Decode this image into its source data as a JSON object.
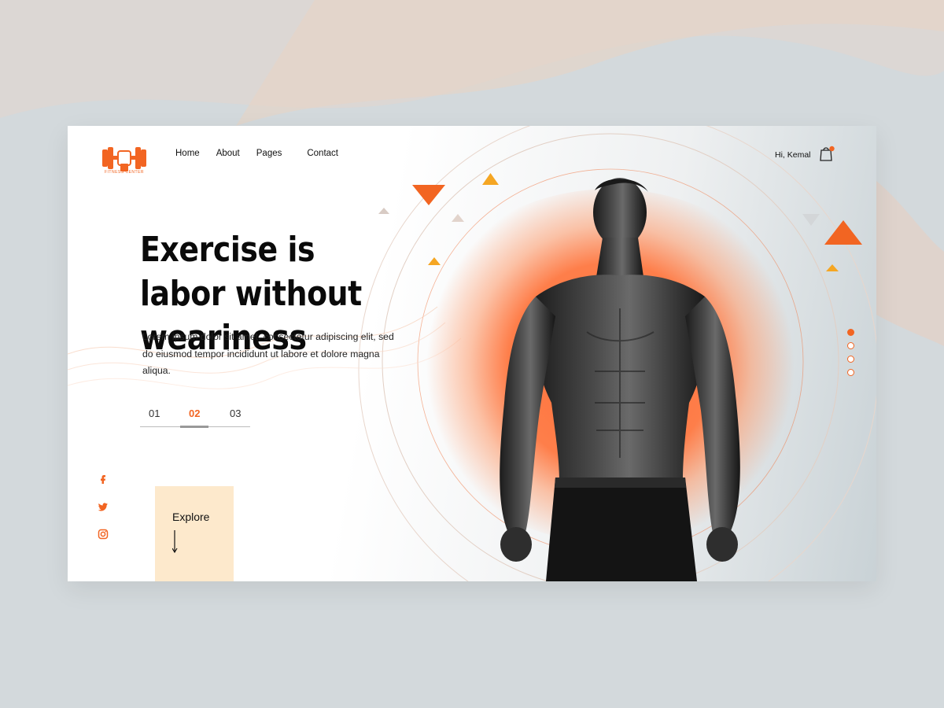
{
  "brand": {
    "logo_text": "FITNESS CENTER",
    "accent_color": "#f26522"
  },
  "nav": {
    "items": [
      "Home",
      "About",
      "Pages",
      "Contact"
    ]
  },
  "header": {
    "greeting": "Hi, Kemal",
    "cart_icon": "shopping-bag-icon"
  },
  "hero": {
    "headline": "Exercise is labor without weariness",
    "body": "Lorem ipsum dolor sit amet, consectetur adipiscing elit, sed do eiusmod tempor incididunt ut labore et dolore magna aliqua.",
    "slides": [
      "01",
      "02",
      "03"
    ],
    "active_slide": "02",
    "explore_label": "Explore"
  },
  "socials": [
    "facebook-icon",
    "twitter-icon",
    "instagram-icon"
  ],
  "pagination": {
    "count": 4,
    "active_index": 0
  }
}
